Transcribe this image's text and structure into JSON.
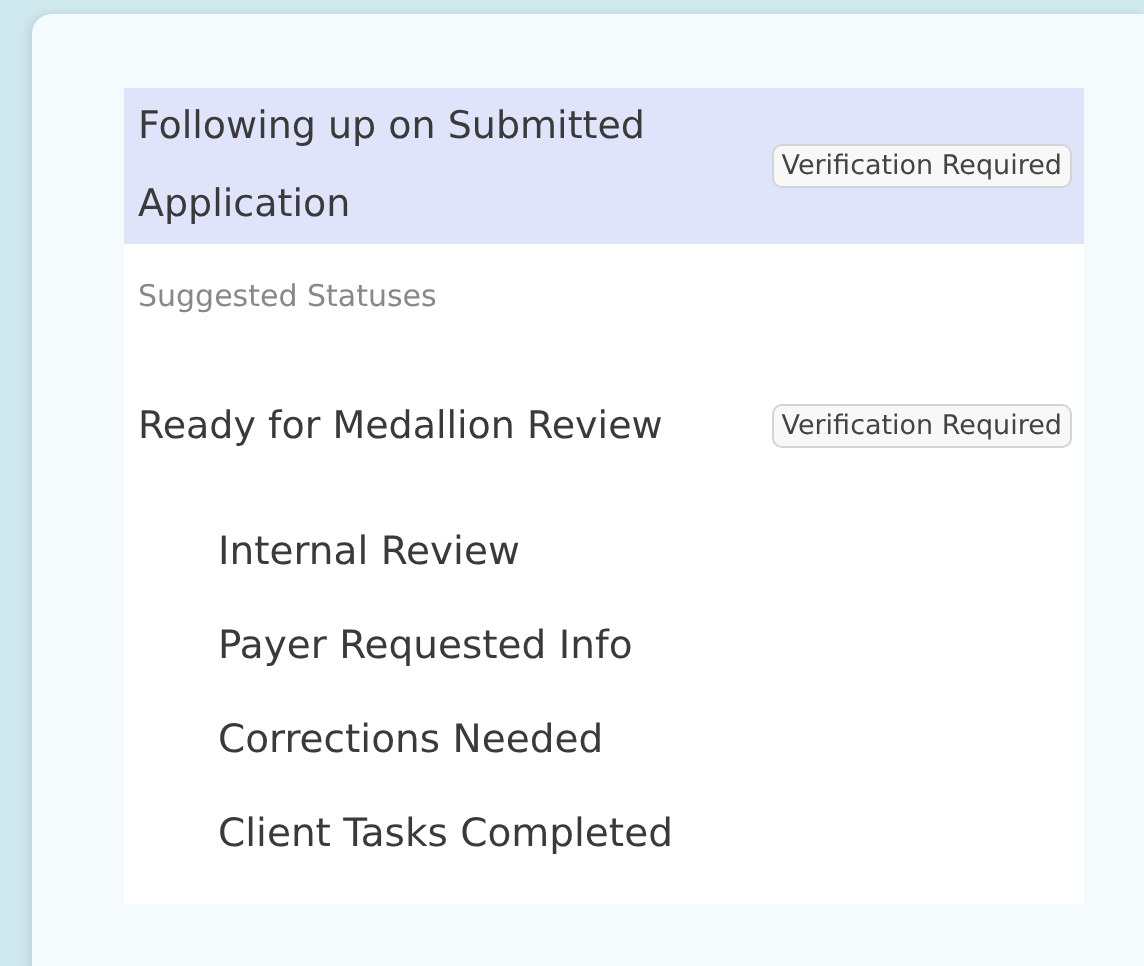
{
  "current_status": {
    "label": "Following up on Submitted Application",
    "badge": "Verification Required",
    "selected": true
  },
  "suggested": {
    "heading": "Suggested Statuses",
    "items": [
      {
        "label": "Ready for Medallion Review",
        "badge": "Verification Required",
        "selected": false,
        "children": [
          {
            "label": "Internal Review",
            "selected": false
          },
          {
            "label": "Payer Requested Info",
            "selected": false
          },
          {
            "label": "Corrections Needed",
            "selected": false
          },
          {
            "label": "Client Tasks Completed",
            "selected": false
          }
        ]
      }
    ]
  }
}
